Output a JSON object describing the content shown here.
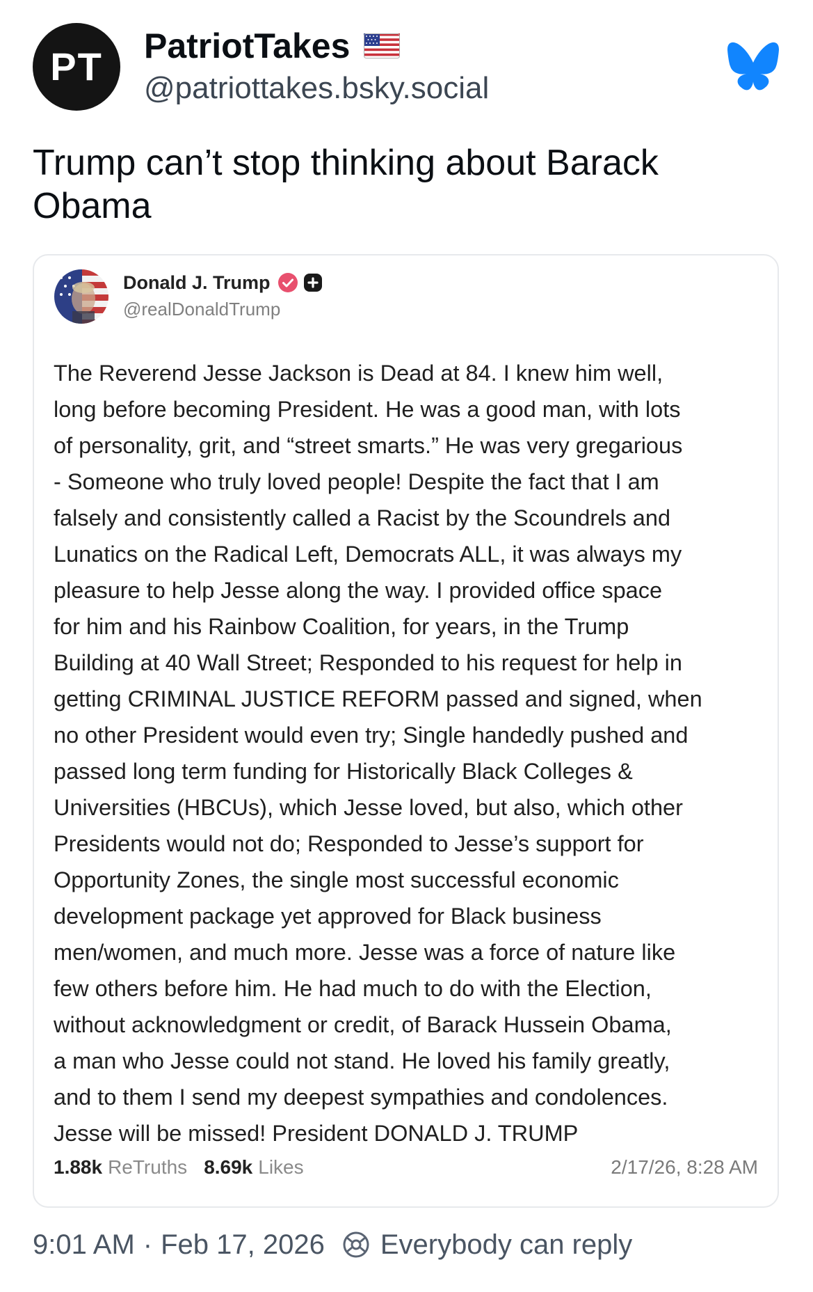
{
  "post": {
    "author": {
      "avatar_text": "PT",
      "display_name": "PatriotTakes",
      "handle": "@patriottakes.bsky.social",
      "flag_icon": "us-flag-icon"
    },
    "platform_icon": "bluesky-butterfly-icon",
    "text": "Trump can’t stop thinking about Barack Obama",
    "footer": {
      "time": "9:01 AM",
      "separator": "·",
      "date": "Feb 17, 2026",
      "reply_setting": "Everybody can reply"
    }
  },
  "embed": {
    "author": {
      "display_name": "Donald J. Trump",
      "handle": "@realDonaldTrump"
    },
    "body": "The Reverend Jesse Jackson is Dead at 84. I knew him well,\nlong before becoming President. He was a good man, with lots\nof personality, grit, and “street smarts.” He was very gregarious\n- Someone who truly loved people! Despite the fact that I am\nfalsely and consistently called a Racist by the Scoundrels and\nLunatics on the Radical Left, Democrats ALL, it was always my\npleasure to help Jesse along the way. I provided office space\nfor him and his Rainbow Coalition, for years, in the Trump\nBuilding at 40 Wall Street; Responded to his request for help in\ngetting CRIMINAL JUSTICE REFORM passed and signed, when\nno other President would even try; Single handedly pushed and\npassed long term funding for Historically Black Colleges &\nUniversities (HBCUs), which Jesse loved, but also, which other\nPresidents would not do; Responded to Jesse’s support for\nOpportunity Zones, the single most successful economic\ndevelopment package yet approved for Black business\nmen/women, and much more. Jesse was a force of nature like\nfew others before him. He had much to do with the Election,\nwithout acknowledgment or credit, of Barack Hussein Obama,\na man who Jesse could not stand. He loved his family greatly,\nand to them I send my deepest sympathies and condolences.\nJesse will be missed! President DONALD J. TRUMP",
    "stats": {
      "retruths_count": "1.88k",
      "retruths_label": "ReTruths",
      "likes_count": "8.69k",
      "likes_label": "Likes"
    },
    "timestamp": "2/17/26, 8:28 AM"
  },
  "colors": {
    "bluesky_blue": "#1185fe",
    "verified_pink": "#e8506e",
    "text_primary": "#0b0f14",
    "text_secondary": "#4a5563"
  }
}
